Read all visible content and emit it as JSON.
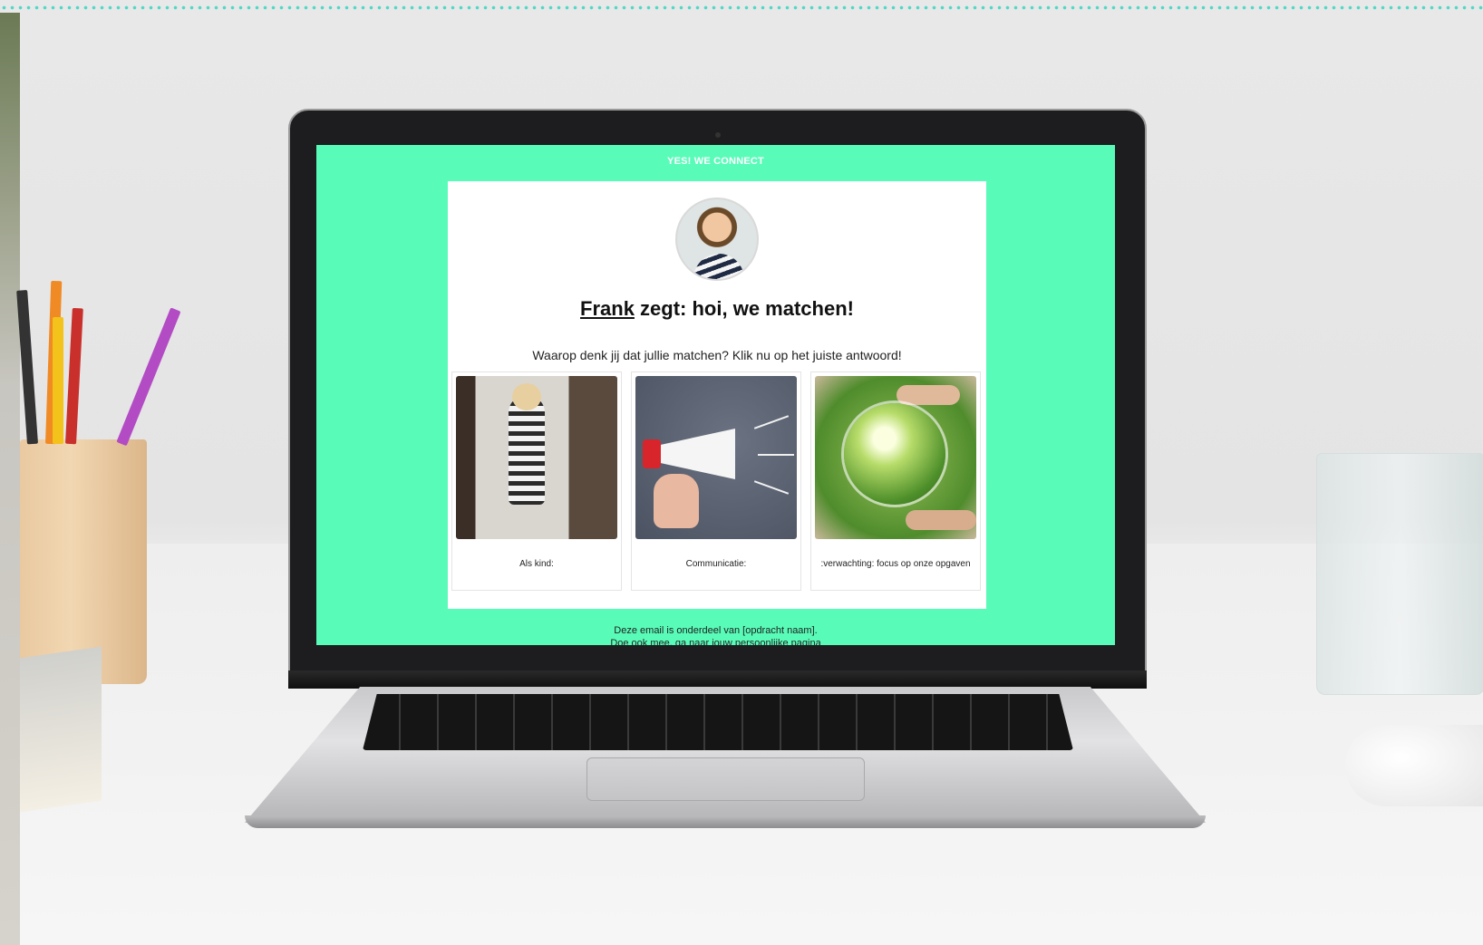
{
  "email": {
    "brand": "YES! WE CONNECT",
    "headline": {
      "name": "Frank",
      "text": " zegt: hoi, we matchen!"
    },
    "question": "Waarop denk jij dat jullie matchen? Klik nu op het juiste antwoord!",
    "options": [
      {
        "label": "Als kind:"
      },
      {
        "label": "Communicatie:"
      },
      {
        "label": ":verwachting: focus op onze opgaven"
      }
    ],
    "footer": {
      "line1": "Deze email is onderdeel van [opdracht naam].",
      "line2": "Doe ook mee, ga naar jouw persoonlijke pagina"
    }
  },
  "colors": {
    "screen_bg": "#58fcb8",
    "dots": "#4fd8c6"
  }
}
